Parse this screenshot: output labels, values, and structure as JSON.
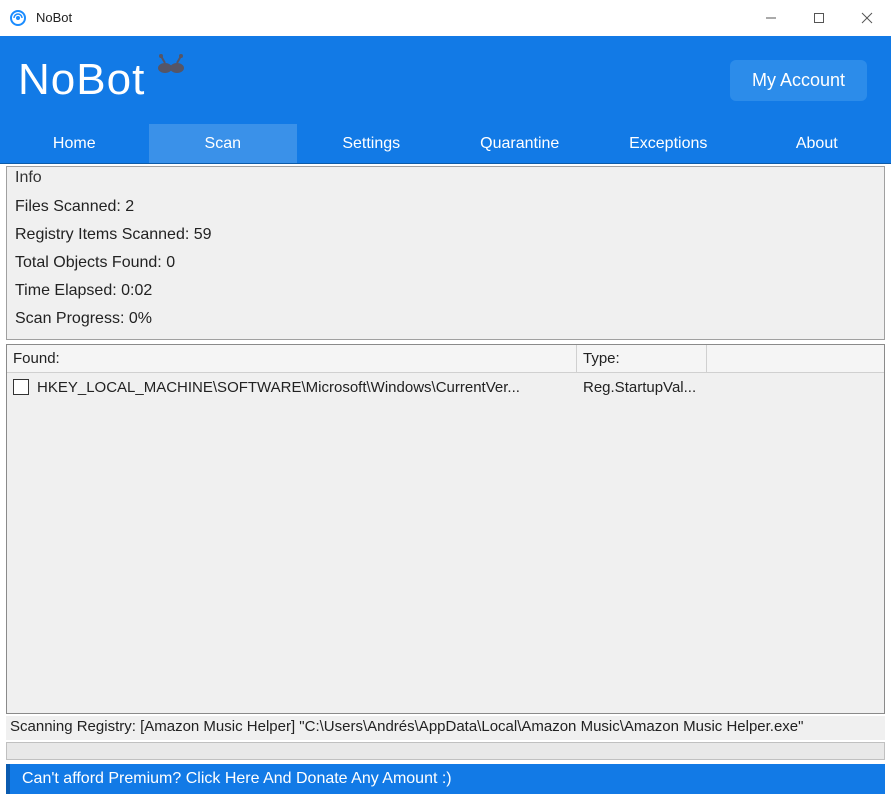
{
  "titlebar": {
    "title": "NoBot"
  },
  "header": {
    "logo": "NoBot",
    "my_account_label": "My Account"
  },
  "nav": {
    "tabs": [
      {
        "label": "Home",
        "active": false
      },
      {
        "label": "Scan",
        "active": true
      },
      {
        "label": "Settings",
        "active": false
      },
      {
        "label": "Quarantine",
        "active": false
      },
      {
        "label": "Exceptions",
        "active": false
      },
      {
        "label": "About",
        "active": false
      }
    ]
  },
  "info": {
    "title": "Info",
    "files_scanned_label": "Files Scanned:",
    "files_scanned_value": "2",
    "registry_scanned_label": "Registry Items Scanned:",
    "registry_scanned_value": "59",
    "total_found_label": "Total Objects Found:",
    "total_found_value": "0",
    "time_elapsed_label": "Time Elapsed:",
    "time_elapsed_value": "0:02",
    "progress_label": "Scan Progress:",
    "progress_value": "0%"
  },
  "results": {
    "col_found": "Found:",
    "col_type": "Type:",
    "rows": [
      {
        "found": "HKEY_LOCAL_MACHINE\\SOFTWARE\\Microsoft\\Windows\\CurrentVer...",
        "type": "Reg.StartupVal..."
      }
    ]
  },
  "scan_status": "Scanning Registry: [Amazon Music Helper] \"C:\\Users\\Andrés\\AppData\\Local\\Amazon Music\\Amazon Music Helper.exe\"",
  "banner": {
    "text": "Can't afford Premium? Click Here And Donate Any Amount :)"
  }
}
